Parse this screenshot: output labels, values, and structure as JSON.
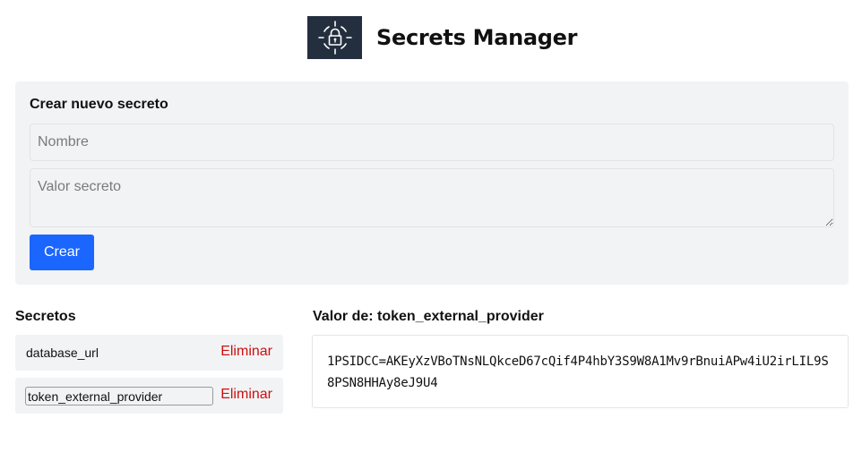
{
  "app": {
    "title": "Secrets Manager",
    "logo_icon": "shield-lock-icon",
    "colors": {
      "logo_bg": "#232f3e",
      "accent": "#1a66ff",
      "danger": "#cc1111",
      "panel": "#f2f3f5"
    }
  },
  "create": {
    "title": "Crear nuevo secreto",
    "name_placeholder": "Nombre",
    "value_placeholder": "Valor secreto",
    "button_label": "Crear"
  },
  "list": {
    "title": "Secretos",
    "items": [
      {
        "name": "database_url",
        "delete_label": "Eliminar"
      },
      {
        "name": "token_external_provider",
        "delete_label": "Eliminar",
        "selected": true
      }
    ]
  },
  "detail": {
    "title_prefix": "Valor de: ",
    "title": "Valor de: token_external_provider",
    "value": "1PSIDCC=AKEyXzVBoTNsNLQkceD67cQif4P4hbY3S9W8A1Mv9rBnuiAPw4iU2irLIL9S8PSN8HHAy8eJ9U4"
  }
}
